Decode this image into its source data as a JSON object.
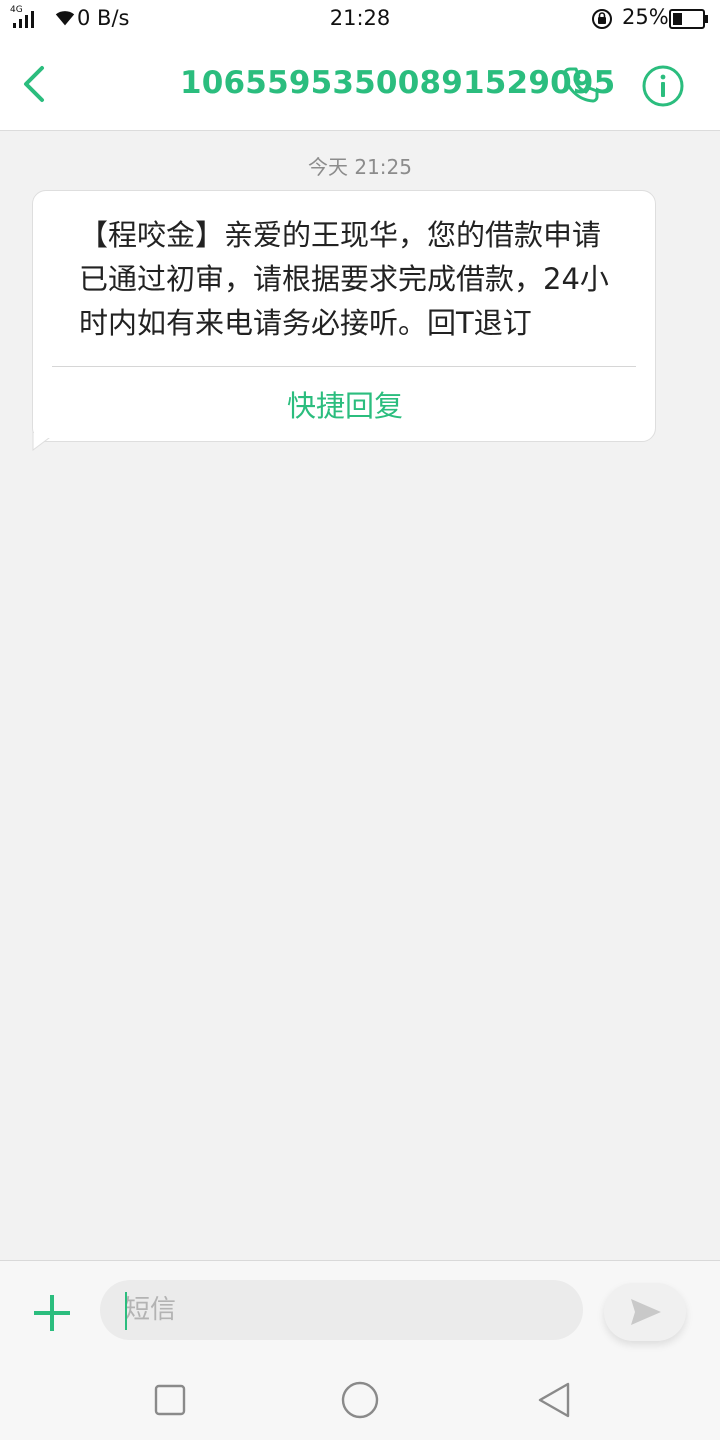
{
  "status_bar": {
    "network_type": "4G",
    "net_speed": "0 B/s",
    "time": "21:28",
    "battery": "25%",
    "icons": [
      "signal-icon",
      "wifi-icon",
      "rotation-lock-icon",
      "battery-icon"
    ]
  },
  "header": {
    "contact": "10655953500891529095",
    "icons": [
      "back-arrow-icon",
      "phone-icon",
      "info-icon"
    ]
  },
  "conversation": {
    "timestamp": "今天 21:25",
    "messages": [
      {
        "text": "【程咬金】亲爱的王现华，您的借款申请已通过初审，请根据要求完成借款，24小时内如有来电请务必接听。回T退订",
        "action": "快捷回复"
      }
    ]
  },
  "compose": {
    "placeholder": "短信",
    "value": "",
    "icons": [
      "plus-icon",
      "send-icon"
    ]
  },
  "navbar": {
    "icons": [
      "recents-square-icon",
      "home-circle-icon",
      "back-triangle-icon"
    ]
  },
  "colors": {
    "accent": "#2bbd7e",
    "background": "#f2f2f2",
    "bubble": "#ffffff"
  }
}
